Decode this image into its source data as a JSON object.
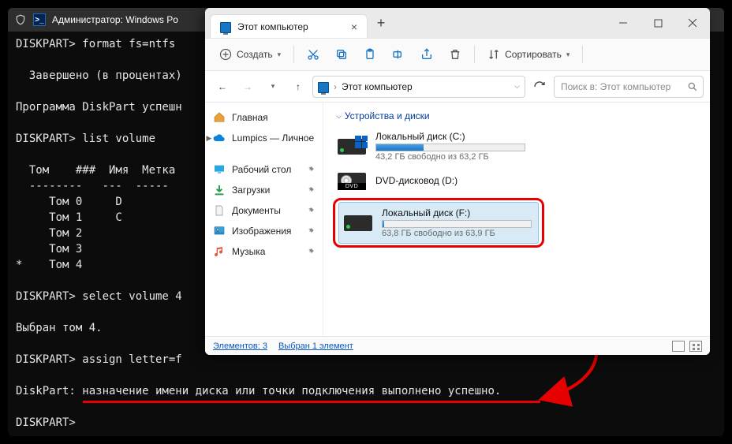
{
  "terminal": {
    "title": "Администратор: Windows Po",
    "lines": [
      "DISKPART> format fs=ntfs ",
      "",
      "  Завершено (в процентах)",
      "",
      "Программа DiskPart успешн",
      "",
      "DISKPART> list volume",
      "",
      "  Том    ###  Имя  Метка ",
      "  --------   ---  -----",
      "     Том 0     D",
      "     Том 1     C",
      "     Том 2",
      "     Том 3",
      "*    Том 4",
      "",
      "DISKPART> select volume 4",
      "",
      "Выбран том 4.",
      "",
      "DISKPART> assign letter=f",
      "",
      "DiskPart: назначение имени диска или точки подключения выполнено успешно.",
      "",
      "DISKPART>"
    ]
  },
  "explorer": {
    "tab_title": "Этот компьютер",
    "toolbar": {
      "create": "Создать",
      "sort": "Сортировать"
    },
    "breadcrumb": "Этот компьютер",
    "search_placeholder": "Поиск в: Этот компьютер",
    "sidebar": {
      "home": "Главная",
      "onedrive": "Lumpics — Личное",
      "desktop": "Рабочий стол",
      "downloads": "Загрузки",
      "documents": "Документы",
      "pictures": "Изображения",
      "music": "Музыка"
    },
    "group_header": "Устройства и диски",
    "drives": {
      "c": {
        "name": "Локальный диск (C:)",
        "sub": "43,2 ГБ свободно из 63,2 ГБ",
        "fill_pct": 32
      },
      "d": {
        "name": "DVD-дисковод (D:)",
        "dvd_label": "DVD"
      },
      "f": {
        "name": "Локальный диск (F:)",
        "sub": "63,8 ГБ свободно из 63,9 ГБ"
      }
    },
    "status": {
      "count": "Элементов: 3",
      "selection": "Выбран 1 элемент"
    }
  }
}
